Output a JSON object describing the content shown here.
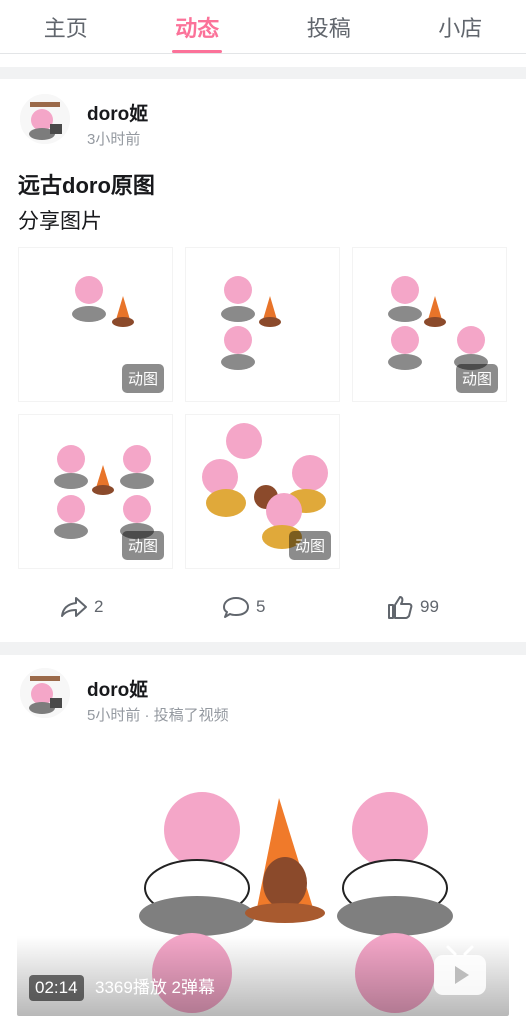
{
  "tabs": [
    {
      "label": "主页",
      "active": false
    },
    {
      "label": "动态",
      "active": true
    },
    {
      "label": "投稿",
      "active": false
    },
    {
      "label": "小店",
      "active": false
    }
  ],
  "accent_color": "#fb7299",
  "posts": [
    {
      "author": "doro姬",
      "time": "3小时前",
      "title": "远古doro原图",
      "text": "分享图片",
      "images": [
        {
          "badge": "动图"
        },
        {
          "badge": ""
        },
        {
          "badge": "动图"
        },
        {
          "badge": "动图"
        },
        {
          "badge": "动图"
        }
      ],
      "actions": {
        "share": "2",
        "comment": "5",
        "like": "99"
      }
    },
    {
      "author": "doro姬",
      "time_meta": "5小时前 · 投稿了视频",
      "video": {
        "duration": "02:14",
        "stats": "3369播放  2弹幕"
      }
    }
  ]
}
